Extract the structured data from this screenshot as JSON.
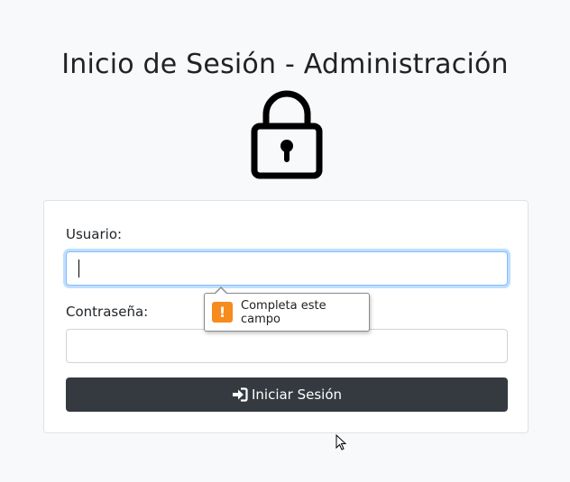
{
  "page": {
    "title": "Inicio de Sesión - Administración"
  },
  "form": {
    "username_label": "Usuario:",
    "username_value": "",
    "password_label": "Contraseña:",
    "password_value": "",
    "submit_label": "Iniciar Sesión",
    "submit_icon": "sign-in-icon"
  },
  "validation": {
    "message": "Completa este campo",
    "icon": "warning-icon",
    "icon_glyph": "!"
  },
  "colors": {
    "background": "#f8f9fa",
    "button": "#343a40",
    "focus_border": "#80bdff",
    "warning": "#f68b1e"
  }
}
